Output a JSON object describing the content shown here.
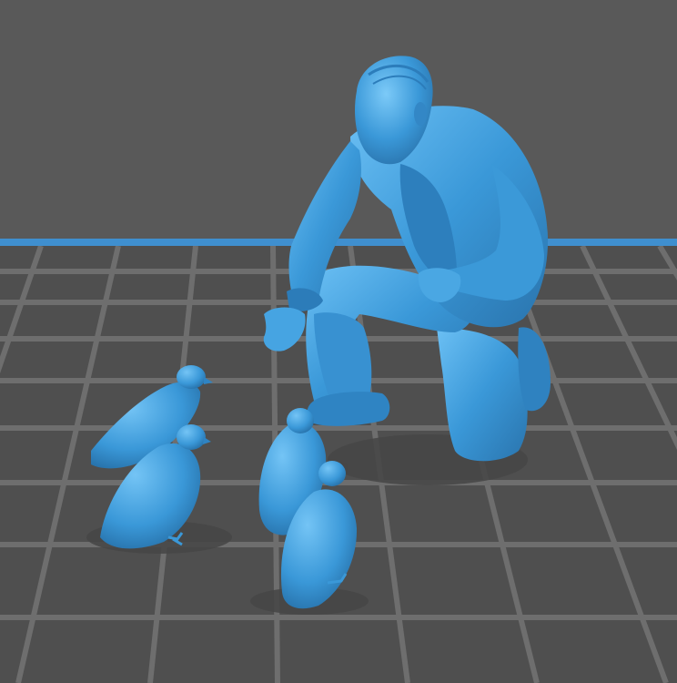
{
  "viewer": {
    "background_color": "#595959",
    "floor_color": "#4d4d4d",
    "grid_line_color": "#6b6b6b",
    "horizon_line_color": "#3f8fcf",
    "model_color": "#3a98d8",
    "model_shadow_color": "#2a74ad",
    "model_highlight_color": "#6cc0f4"
  }
}
